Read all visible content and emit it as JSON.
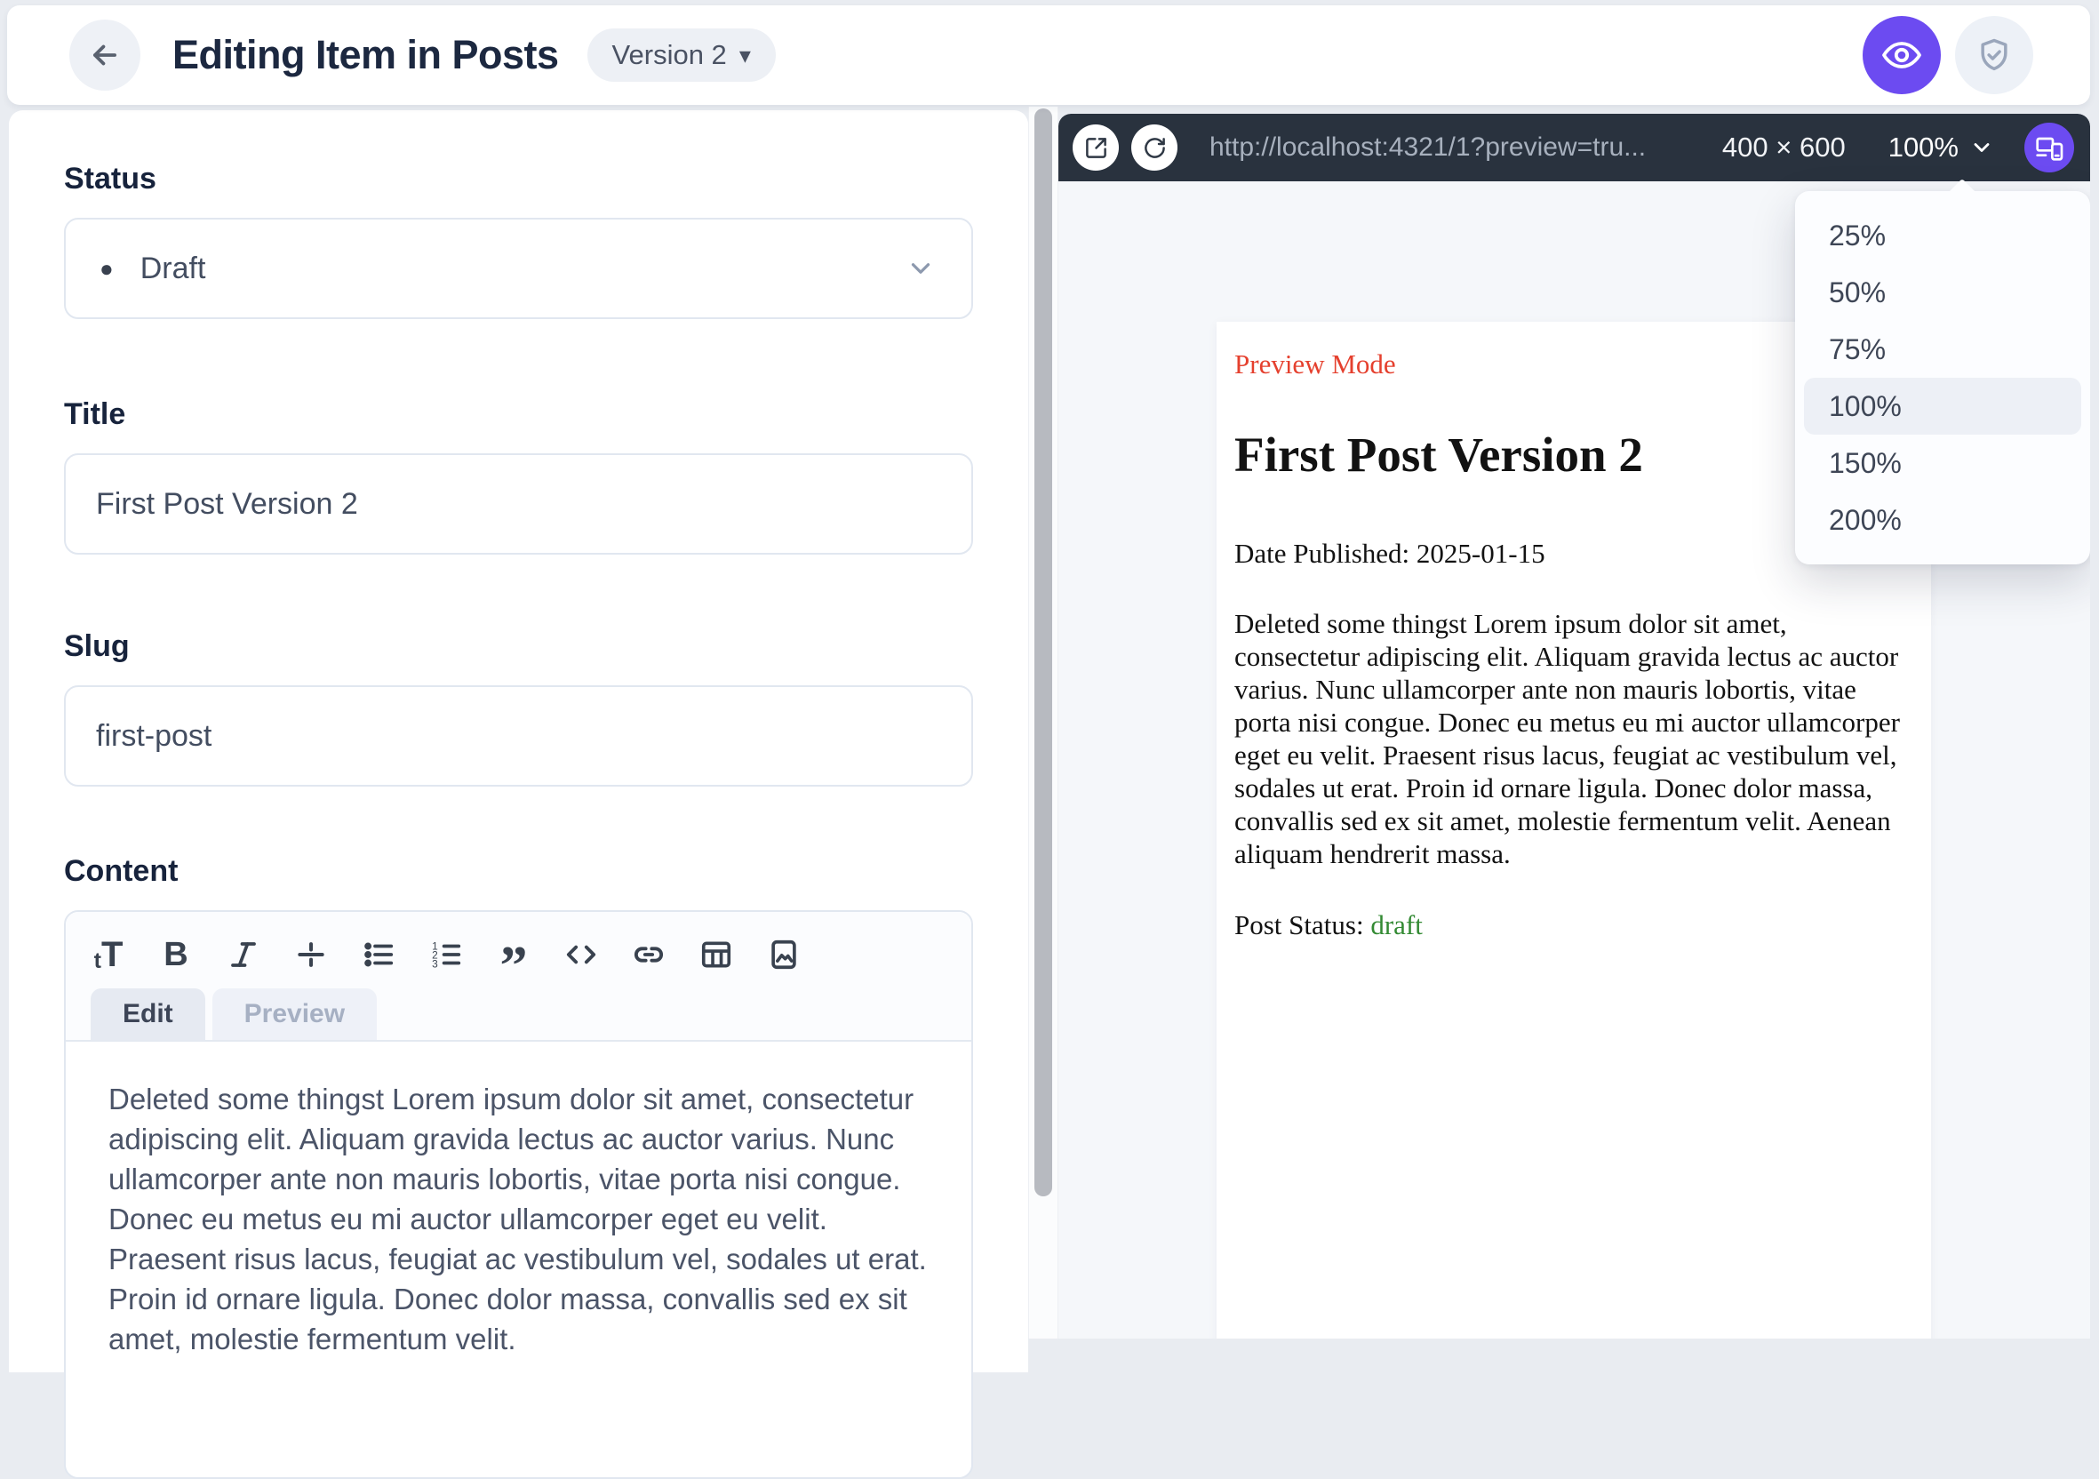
{
  "header": {
    "title": "Editing Item in Posts",
    "version_label": "Version 2"
  },
  "form": {
    "status": {
      "label": "Status",
      "value": "Draft"
    },
    "title": {
      "label": "Title",
      "value": "First Post Version 2"
    },
    "slug": {
      "label": "Slug",
      "value": "first-post"
    },
    "content": {
      "label": "Content",
      "toolbar_icons": [
        "text-size",
        "bold",
        "italic",
        "strikethrough",
        "bullet-list",
        "ordered-list",
        "blockquote",
        "code",
        "link",
        "table",
        "image"
      ],
      "tabs": {
        "edit": "Edit",
        "preview": "Preview"
      },
      "value": "Deleted some thingst Lorem ipsum dolor sit amet, consectetur adipiscing elit. Aliquam gravida lectus ac auctor varius. Nunc ullamcorper ante non mauris lobortis, vitae porta nisi congue. Donec eu metus eu mi auctor ullamcorper eget eu velit. Praesent risus lacus, feugiat ac vestibulum vel, sodales ut erat. Proin id ornare ligula. Donec dolor massa, convallis sed ex sit amet, molestie fermentum velit."
    }
  },
  "preview": {
    "toolbar": {
      "url": "http://localhost:4321/1?preview=tru...",
      "dimensions": "400 × 600",
      "zoom": "100%"
    },
    "zoom_menu": {
      "options": [
        "25%",
        "50%",
        "75%",
        "100%",
        "150%",
        "200%"
      ],
      "selected": "100%"
    },
    "page": {
      "badge": "Preview Mode",
      "heading": "First Post Version 2",
      "date_line": "Date Published: 2025-01-15",
      "body": "Deleted some thingst Lorem ipsum dolor sit amet, consectetur adipiscing elit. Aliquam gravida lectus ac auctor varius. Nunc ullamcorper ante non mauris lobortis, vitae porta nisi congue. Donec eu metus eu mi auctor ullamcorper eget eu velit. Praesent risus lacus, feugiat ac vestibulum vel, sodales ut erat. Proin id ornare ligula. Donec dolor massa, convallis sed ex sit amet, molestie fermentum velit. Aenean aliquam hendrerit massa.",
      "status_label": "Post Status: ",
      "status_value": "draft"
    }
  },
  "glyphs": {
    "caret_down": "▾",
    "status_dot": "●",
    "blockquote_icon": "”",
    "bold_icon": "B",
    "text_size_small": "t",
    "text_size_large": "T"
  },
  "colors": {
    "accent_purple": "#6c4bf1",
    "toolbar_dark": "#29323e",
    "badge_red": "#e5402e",
    "status_green": "#338a33",
    "page_background": "#e9ecf1"
  }
}
